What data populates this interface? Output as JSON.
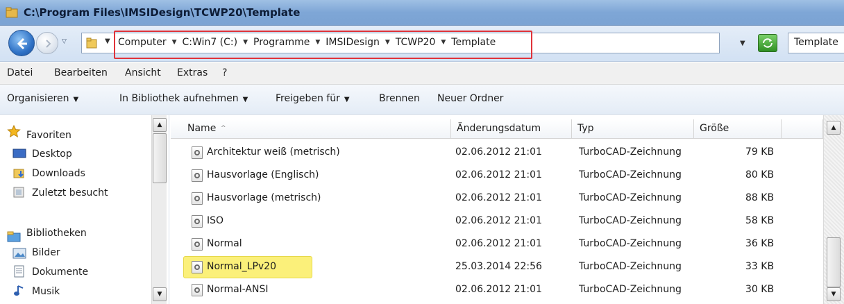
{
  "window": {
    "title": "C:\\Program Files\\IMSIDesign\\TCWP20\\Template"
  },
  "address": {
    "crumbs": [
      "Computer",
      "C:Win7 (C:)",
      "Programme",
      "IMSIDesign",
      "TCWP20",
      "Template"
    ],
    "search_value": "Template"
  },
  "menu": [
    "Datei",
    "Bearbeiten",
    "Ansicht",
    "Extras",
    "?"
  ],
  "toolbar": {
    "organize": "Organisieren",
    "library": "In Bibliothek aufnehmen",
    "share": "Freigeben für",
    "burn": "Brennen",
    "new_folder": "Neuer Ordner"
  },
  "nav": {
    "favorites": "Favoriten",
    "desktop": "Desktop",
    "downloads": "Downloads",
    "recent": "Zuletzt besucht",
    "libraries": "Bibliotheken",
    "pictures": "Bilder",
    "documents": "Dokumente",
    "music": "Musik"
  },
  "columns": {
    "name": "Name",
    "date": "Änderungsdatum",
    "type": "Typ",
    "size": "Größe"
  },
  "files": [
    {
      "name": "Architektur weiß (metrisch)",
      "date": "02.06.2012 21:01",
      "type": "TurboCAD-Zeichnung",
      "size": "79 KB"
    },
    {
      "name": "Hausvorlage (Englisch)",
      "date": "02.06.2012 21:01",
      "type": "TurboCAD-Zeichnung",
      "size": "80 KB"
    },
    {
      "name": "Hausvorlage (metrisch)",
      "date": "02.06.2012 21:01",
      "type": "TurboCAD-Zeichnung",
      "size": "88 KB"
    },
    {
      "name": "ISO",
      "date": "02.06.2012 21:01",
      "type": "TurboCAD-Zeichnung",
      "size": "58 KB"
    },
    {
      "name": "Normal",
      "date": "02.06.2012 21:01",
      "type": "TurboCAD-Zeichnung",
      "size": "36 KB"
    },
    {
      "name": "Normal_LPv20",
      "date": "25.03.2014 22:56",
      "type": "TurboCAD-Zeichnung",
      "size": "33 KB",
      "highlighted": true
    },
    {
      "name": "Normal-ANSI",
      "date": "02.06.2012 21:01",
      "type": "TurboCAD-Zeichnung",
      "size": "30 KB"
    }
  ],
  "colors": {
    "highlight_yellow": "#fbf07a",
    "annotation_red": "#e0333a",
    "titlebar": "#7ea6d6"
  }
}
